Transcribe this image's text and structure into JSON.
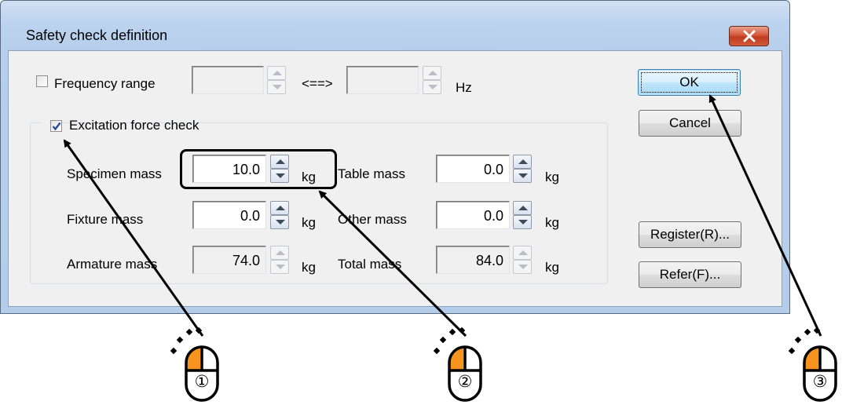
{
  "window": {
    "title": "Safety check definition"
  },
  "frequency": {
    "label": "Frequency range",
    "checked": false,
    "from_value": "",
    "arrow": "<==>",
    "to_value": "",
    "unit": "Hz"
  },
  "excitation": {
    "label": "Excitation force check",
    "checked": true,
    "specimen_mass": {
      "label": "Specimen mass",
      "value": "10.0",
      "unit": "kg"
    },
    "table_mass": {
      "label": "Table mass",
      "value": "0.0",
      "unit": "kg"
    },
    "fixture_mass": {
      "label": "Fixture  mass",
      "value": "0.0",
      "unit": "kg"
    },
    "other_mass": {
      "label": "Other mass",
      "value": "0.0",
      "unit": "kg"
    },
    "armature_mass": {
      "label": "Armature mass",
      "value": "74.0",
      "unit": "kg"
    },
    "total_mass": {
      "label": "Total mass",
      "value": "84.0",
      "unit": "kg"
    }
  },
  "buttons": {
    "ok": "OK",
    "cancel": "Cancel",
    "register": "Register(R)...",
    "refer": "Refer(F)..."
  },
  "annotations": {
    "step1": "①",
    "step2": "②",
    "step3": "③",
    "mouse_accent": "#f7931e"
  },
  "icons": [
    "close-icon",
    "checkmark-icon",
    "spin-up-icon",
    "spin-down-icon",
    "mouse-icon",
    "click-sparkle-icon"
  ]
}
